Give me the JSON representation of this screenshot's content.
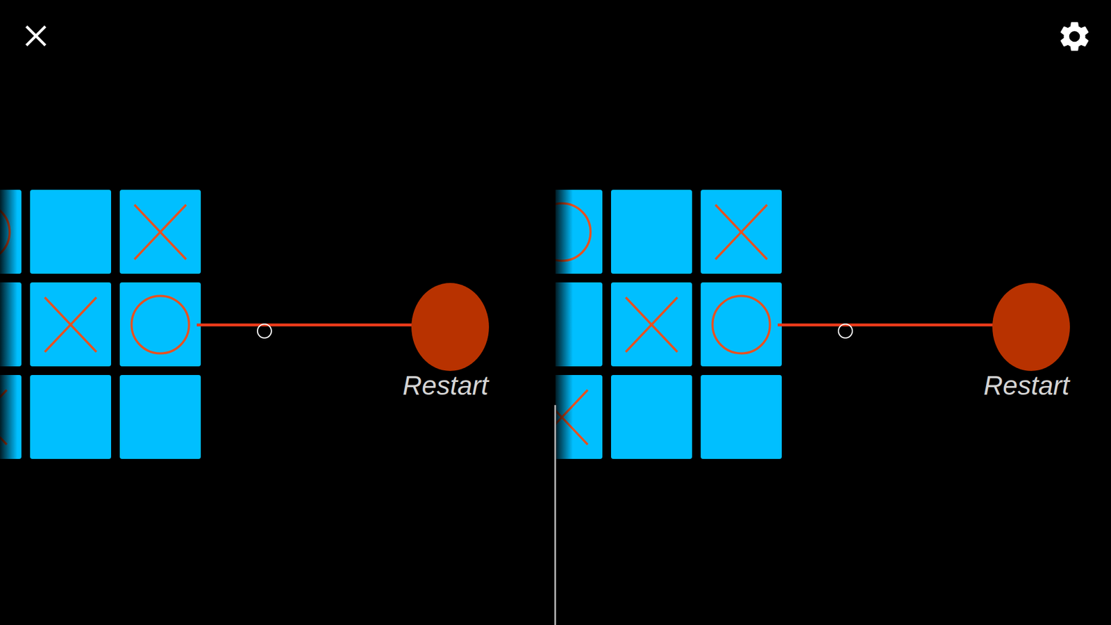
{
  "board": {
    "cells": [
      {
        "mark": "O"
      },
      {
        "mark": ""
      },
      {
        "mark": "X"
      },
      {
        "mark": ""
      },
      {
        "mark": "X"
      },
      {
        "mark": "O"
      },
      {
        "mark": "X"
      },
      {
        "mark": ""
      },
      {
        "mark": ""
      }
    ]
  },
  "restart_button": {
    "label": "Restart"
  }
}
